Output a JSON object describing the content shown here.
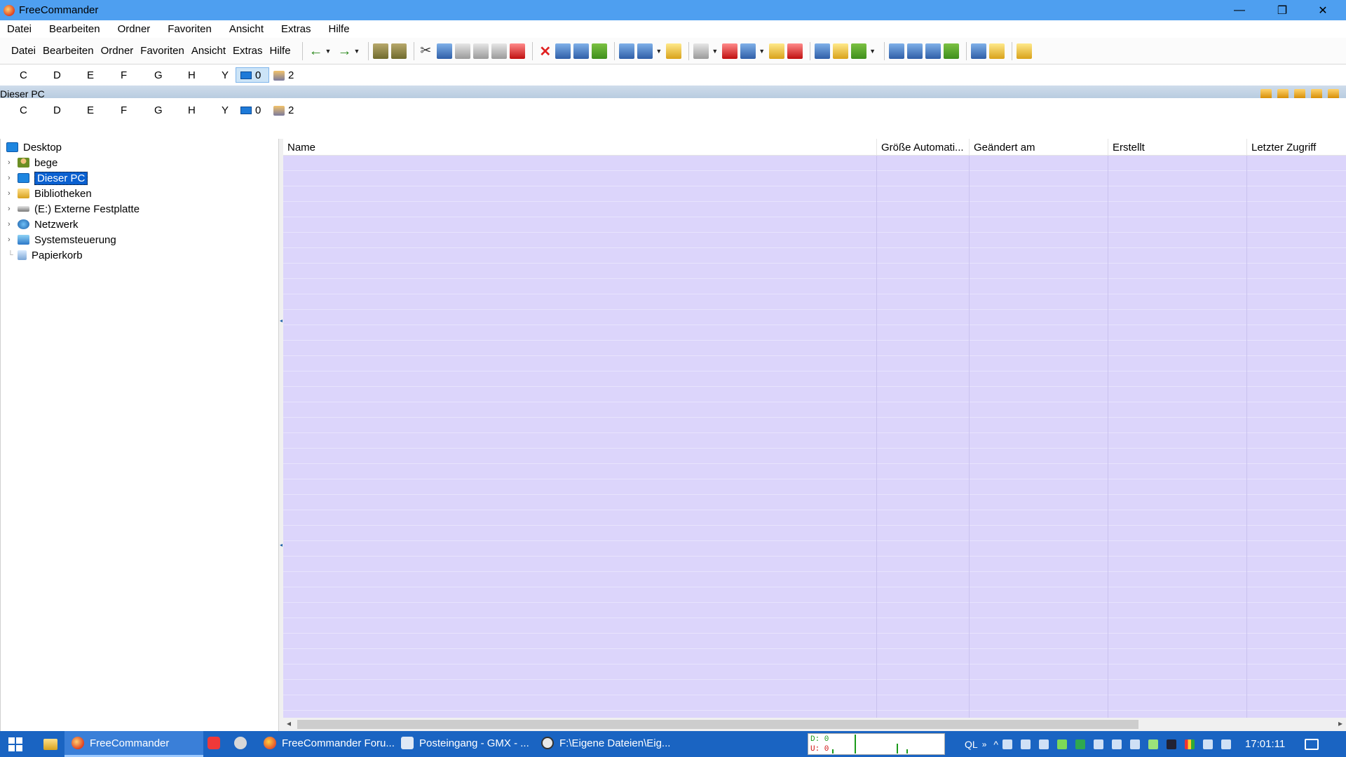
{
  "window": {
    "title": "FreeCommander",
    "controls": {
      "minimize": "—",
      "maximize": "❐",
      "close": "✕"
    }
  },
  "main_menu": [
    "Datei",
    "Bearbeiten",
    "Ordner",
    "Favoriten",
    "Ansicht",
    "Extras",
    "Hilfe"
  ],
  "toolbar_menu": [
    "Datei",
    "Bearbeiten",
    "Ordner",
    "Favoriten",
    "Ansicht",
    "Extras",
    "Hilfe"
  ],
  "drives_top": {
    "letters": [
      "C",
      "D",
      "E",
      "F",
      "G",
      "H",
      "Y"
    ],
    "pc_count": "0",
    "net_count": "2"
  },
  "drives_bottom": {
    "letters": [
      "C",
      "D",
      "E",
      "F",
      "G",
      "H",
      "Y"
    ],
    "pc_count": "0",
    "net_count": "2"
  },
  "path": "Dieser PC",
  "tree": [
    {
      "label": "Desktop",
      "icon": "desktop-icon"
    },
    {
      "label": "bege",
      "icon": "user-folder-icon"
    },
    {
      "label": "Dieser PC",
      "icon": "computer-icon",
      "selected": true
    },
    {
      "label": "Bibliotheken",
      "icon": "libraries-icon"
    },
    {
      "label": "(E:) Externe Festplatte",
      "icon": "hard-drive-icon"
    },
    {
      "label": "Netzwerk",
      "icon": "network-icon"
    },
    {
      "label": "Systemsteuerung",
      "icon": "control-panel-icon"
    },
    {
      "label": "Papierkorb",
      "icon": "recycle-bin-icon"
    }
  ],
  "columns": [
    "Name",
    "Größe Automati...",
    "Geändert am",
    "Erstellt",
    "Letzter Zugriff"
  ],
  "taskbar": {
    "items": [
      {
        "label": "FreeCommander",
        "active": true
      },
      {
        "label": "FreeCommander Foru...",
        "active": false
      },
      {
        "label": "Posteingang - GMX - ...",
        "active": false
      },
      {
        "label": "F:\\Eigene Dateien\\Eig...",
        "active": false
      }
    ],
    "net_download": "D: 0",
    "net_upload": "U: 0",
    "ql": "QL",
    "clock": "17:01:11"
  }
}
